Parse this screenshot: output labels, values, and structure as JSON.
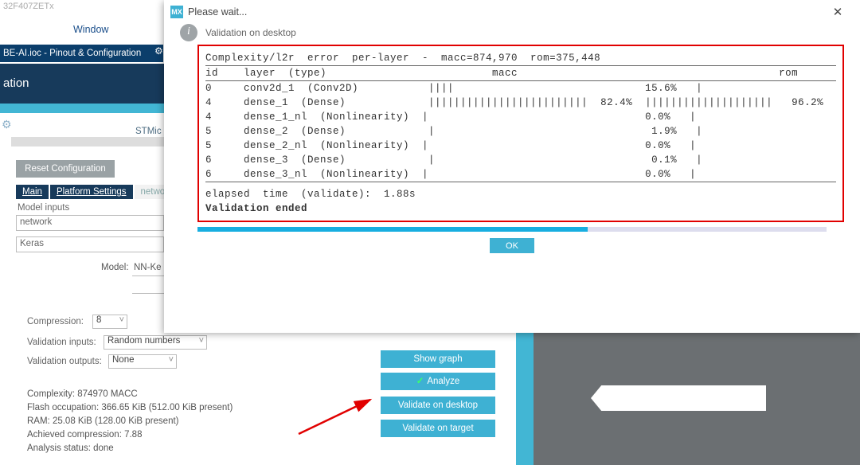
{
  "bg": {
    "top_partial": "32F407ZETx",
    "menu_window": "Window",
    "titlebar_sub": "BE-AI.ioc - Pinout & Configuration",
    "subheader_label": "ation",
    "stmic": "STMic",
    "reset_btn": "Reset Configuration",
    "tabs": {
      "main": "Main",
      "platform": "Platform Settings",
      "network": "network"
    },
    "model_inputs_label": "Model inputs",
    "network_value": "network",
    "keras_value": "Keras",
    "model_label": "Model:",
    "model_value": "NN-Ke",
    "compression_label": "Compression:",
    "compression_value": "8",
    "validation_inputs_label": "Validation inputs:",
    "validation_inputs_value": "Random numbers",
    "validation_outputs_label": "Validation outputs:",
    "validation_outputs_value": "None",
    "stats": {
      "complexity": "Complexity:  874970 MACC",
      "flash": "Flash occupation: 366.65 KiB (512.00 KiB present)",
      "ram": "RAM: 25.08 KiB (128.00 KiB present)",
      "ach": "Achieved compression: 7.88",
      "status": "Analysis status: done"
    },
    "buttons": {
      "showgraph": "Show graph",
      "analyze": "Analyze",
      "vdesktop": "Validate on desktop",
      "vtarget": "Validate on target"
    }
  },
  "dialog": {
    "cube": "MX",
    "title": "Please wait...",
    "subtitle": "Validation on desktop",
    "ok": "OK",
    "progress_pct": 62,
    "header_line": "Complexity/l2r  error  per-layer  -  macc=874,970  rom=375,448",
    "col_header": "id    layer  (type)                          macc                                         rom",
    "rows": [
      {
        "id": "0",
        "text": "conv2d_1  (Conv2D)           ||||                              15.6%   |",
        "pct_rom": ""
      },
      {
        "id": "4",
        "text": "dense_1  (Dense)             |||||||||||||||||||||||||  82.4%  ||||||||||||||||||||   96.2%",
        "pct_rom": ""
      },
      {
        "id": "4",
        "text": "dense_1_nl  (Nonlinearity)  |                                  0.0%   |",
        "pct_rom": ""
      },
      {
        "id": "5",
        "text": "dense_2  (Dense)             |                                  1.9%   |",
        "pct_rom": ""
      },
      {
        "id": "5",
        "text": "dense_2_nl  (Nonlinearity)  |                                  0.0%   |",
        "pct_rom": ""
      },
      {
        "id": "6",
        "text": "dense_3  (Dense)             |                                  0.1%   |",
        "pct_rom": ""
      },
      {
        "id": "6",
        "text": "dense_3_nl  (Nonlinearity)  |                                  0.0%   |",
        "pct_rom": ""
      }
    ],
    "elapsed": "elapsed  time  (validate):  1.88s",
    "ended": "Validation ended"
  }
}
